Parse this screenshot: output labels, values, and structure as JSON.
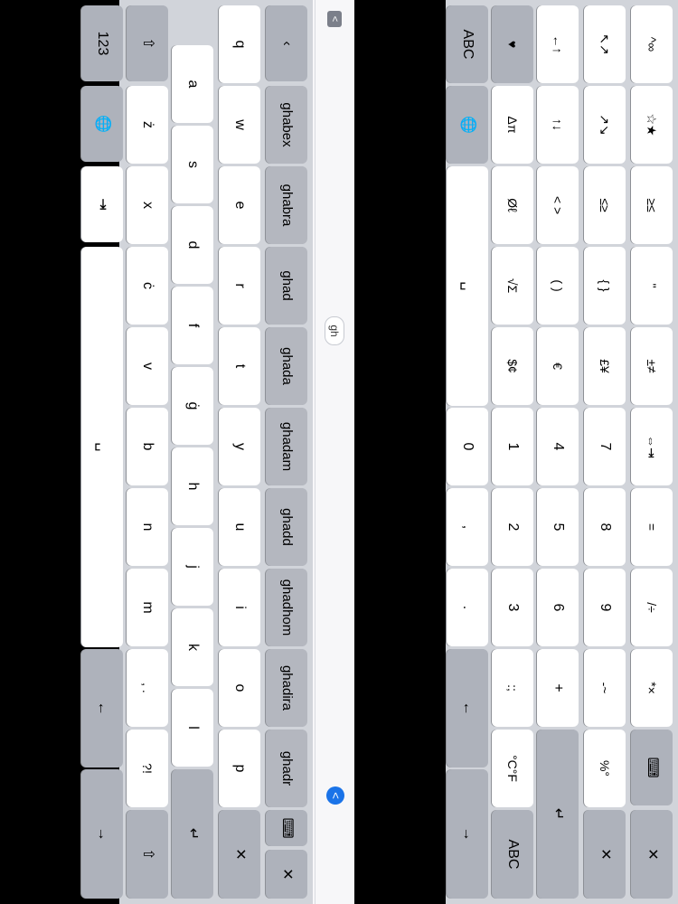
{
  "pane_a": {
    "suggestion_bar": {
      "left_chip": "<",
      "mid_chip": "gh",
      "right_chip": "<"
    },
    "row1": [
      "ghabex",
      "ghabra",
      "ghad",
      "ghada",
      "ghadam",
      "ghadd",
      "ghadhom",
      "ghadira",
      "ghadr"
    ],
    "row1_tail": [
      "⌨",
      "✕",
      "✕"
    ],
    "row2": [
      "q",
      "w",
      "e",
      "r",
      "t",
      "y",
      "u",
      "i",
      "o",
      "p"
    ],
    "row3": [
      "a",
      "s",
      "d",
      "f",
      "ġ",
      "h",
      "j",
      "k",
      "l"
    ],
    "row4": [
      "⇧",
      "ż",
      "x",
      "ċ",
      "v",
      "b",
      "n",
      "m",
      ", .",
      "?!",
      "⇧"
    ],
    "row5": [
      "123",
      "🌐",
      "⇥",
      "␣",
      "←",
      "→"
    ],
    "enter": "↵"
  },
  "pane_b": {
    "row1": [
      "^∞",
      "☆★",
      "≥≤",
      "''",
      "±≠",
      "⇔⇥",
      "=",
      "/÷",
      "*×",
      "⌨",
      "✕"
    ],
    "row2": [
      "↖↗",
      "↗↘",
      "≤≥",
      "{ }",
      "£¥",
      "7",
      "8",
      "9",
      "-~",
      "%°",
      "✕"
    ],
    "row3": [
      "←↑",
      "↑↓",
      "< >",
      "( )",
      "€",
      "4",
      "5",
      "6",
      "+",
      "↵"
    ],
    "row4": [
      "♥",
      "Δπ",
      "Øℓ",
      "√Σ",
      "$¢",
      "1",
      "2",
      "3",
      ":;",
      "°C°F",
      "ABC"
    ],
    "row5": [
      "ABC",
      "🌐",
      "␣",
      "0",
      ",",
      ".",
      "←",
      "→"
    ]
  }
}
